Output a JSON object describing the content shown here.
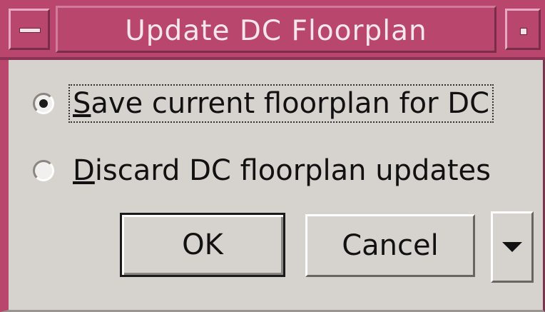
{
  "window": {
    "title": "Update DC Floorplan",
    "menu_icon": "window-menu-icon",
    "maximize_icon": "maximize-icon",
    "accent_color": "#b8466d"
  },
  "options": {
    "save": {
      "prefix": "S",
      "rest": "ave current floorplan for DC",
      "selected": true
    },
    "discard": {
      "prefix": "D",
      "rest": "iscard DC floorplan updates",
      "selected": false
    }
  },
  "buttons": {
    "ok_label": "OK",
    "cancel_label": "Cancel",
    "more_icon": "dropdown-arrow-icon"
  }
}
